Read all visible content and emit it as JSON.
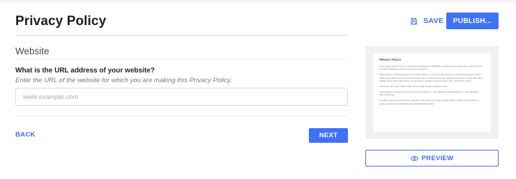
{
  "header": {
    "title": "Privacy Policy",
    "save_label": "SAVE",
    "publish_label": "PUBLISH..."
  },
  "step": {
    "section_title": "Website",
    "question": "What is the URL address of your website?",
    "hint": "Enter the URL of the website for which you are making this Privacy Policy.",
    "url_input": {
      "value": "",
      "placeholder": "www.example.com"
    },
    "back_label": "BACK",
    "next_label": "NEXT"
  },
  "preview": {
    "doc_title": "PRIVACY POLICY",
    "paragraphs": [
      "Lorem ipsum dolor sit amet, consectetur adipiscing elit. Phasellus vestibulum commodo enim eget tincidunt. Curabitur imperdiet commodo risus sed commodo.",
      "Nullam auctor pellentesque pretium. Mauris blandit est sit amet odio tempus, sit amet viverra ipsum finibus. Class aptent taciti sociosqu ad litora torquent per conubia nostra, per inceptos himenaeos. Donec bibendum tristique ipsum quis ullamcorper. Ut risus lacus, faucibus sit amet cursus vitae, tristique id sapien.",
      "Vestibulum leo justo, mollis euismod nunc eget, feugiat vulputate lorem.",
      "Suspendisse consectetur ac odio rhoncus commodo. In hac habitasse platea dictumst. In hac habitasse platea dictumst.",
      "Curabitur egestas rhoncus ante, a lobortis velit ultrices id. Integer blandit tincidunt luctus. Nam efficitur a sapien et placerat. Ut faucibus quis nulla dignissim mollis."
    ],
    "button_label": "PREVIEW"
  },
  "colors": {
    "accent": "#3f72f4",
    "divider": "#d9dbe0",
    "panel_bg": "#eef0f3"
  },
  "icons": {
    "save": "floppy-disk-icon",
    "preview": "eye-icon"
  }
}
